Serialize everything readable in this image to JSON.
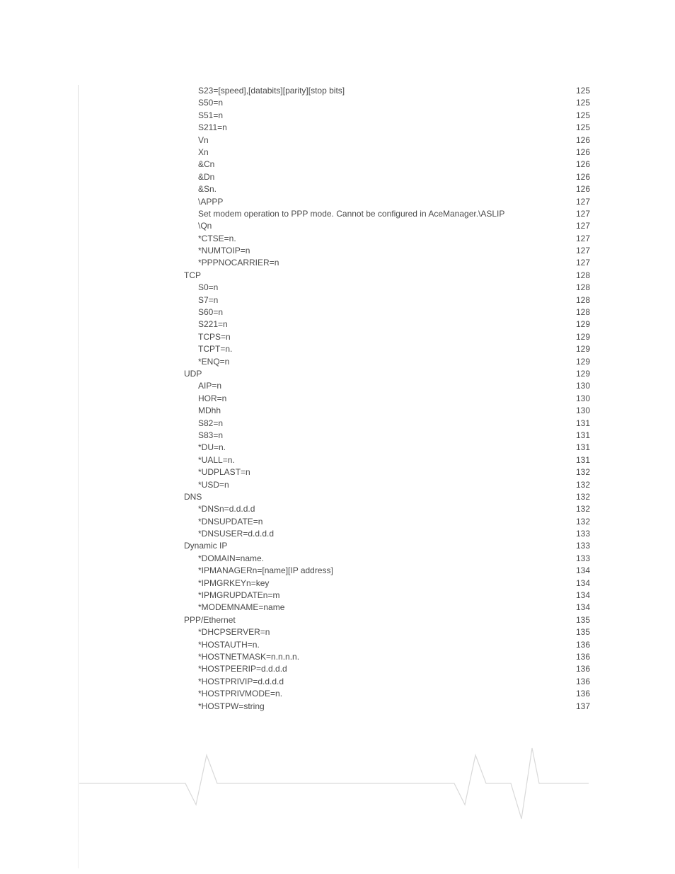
{
  "toc": [
    {
      "label": "S23=[speed],[databits][parity][stop bits]",
      "page": "125",
      "indent": 1
    },
    {
      "label": "S50=n",
      "page": "125",
      "indent": 1
    },
    {
      "label": "S51=n",
      "page": "125",
      "indent": 1
    },
    {
      "label": "S211=n",
      "page": "125",
      "indent": 1
    },
    {
      "label": "Vn",
      "page": "126",
      "indent": 1
    },
    {
      "label": "Xn",
      "page": "126",
      "indent": 1
    },
    {
      "label": "&Cn",
      "page": "126",
      "indent": 1
    },
    {
      "label": "&Dn",
      "page": "126",
      "indent": 1
    },
    {
      "label": "&Sn.",
      "page": "126",
      "indent": 1
    },
    {
      "label": "\\APPP",
      "page": "127",
      "indent": 1
    },
    {
      "label": "Set modem operation to PPP mode. Cannot be configured in AceManager.\\ASLIP",
      "page": "127",
      "indent": 1
    },
    {
      "label": "\\Qn",
      "page": "127",
      "indent": 1
    },
    {
      "label": "*CTSE=n.",
      "page": "127",
      "indent": 1
    },
    {
      "label": "*NUMTOIP=n",
      "page": "127",
      "indent": 1
    },
    {
      "label": "*PPPNOCARRIER=n",
      "page": "127",
      "indent": 1
    },
    {
      "label": "TCP",
      "page": "128",
      "indent": 0
    },
    {
      "label": "S0=n",
      "page": "128",
      "indent": 1
    },
    {
      "label": "S7=n",
      "page": "128",
      "indent": 1
    },
    {
      "label": "S60=n",
      "page": "128",
      "indent": 1
    },
    {
      "label": "S221=n",
      "page": "129",
      "indent": 1
    },
    {
      "label": "TCPS=n",
      "page": "129",
      "indent": 1
    },
    {
      "label": "TCPT=n.",
      "page": "129",
      "indent": 1
    },
    {
      "label": "*ENQ=n",
      "page": "129",
      "indent": 1
    },
    {
      "label": "UDP",
      "page": "129",
      "indent": 0
    },
    {
      "label": "AIP=n",
      "page": "130",
      "indent": 1
    },
    {
      "label": "HOR=n",
      "page": "130",
      "indent": 1
    },
    {
      "label": "MDhh",
      "page": "130",
      "indent": 1
    },
    {
      "label": "S82=n",
      "page": "131",
      "indent": 1
    },
    {
      "label": "S83=n",
      "page": "131",
      "indent": 1
    },
    {
      "label": "*DU=n.",
      "page": "131",
      "indent": 1
    },
    {
      "label": "*UALL=n.",
      "page": "131",
      "indent": 1
    },
    {
      "label": "*UDPLAST=n",
      "page": "132",
      "indent": 1
    },
    {
      "label": "*USD=n",
      "page": "132",
      "indent": 1
    },
    {
      "label": "DNS",
      "page": "132",
      "indent": 0
    },
    {
      "label": "*DNSn=d.d.d.d",
      "page": "132",
      "indent": 1
    },
    {
      "label": "*DNSUPDATE=n",
      "page": "132",
      "indent": 1
    },
    {
      "label": "*DNSUSER=d.d.d.d",
      "page": "133",
      "indent": 1
    },
    {
      "label": "Dynamic IP",
      "page": "133",
      "indent": 0
    },
    {
      "label": "*DOMAIN=name.",
      "page": "133",
      "indent": 1
    },
    {
      "label": "*IPMANAGERn=[name][IP address]",
      "page": "134",
      "indent": 1
    },
    {
      "label": "*IPMGRKEYn=key",
      "page": "134",
      "indent": 1
    },
    {
      "label": "*IPMGRUPDATEn=m",
      "page": "134",
      "indent": 1
    },
    {
      "label": "*MODEMNAME=name",
      "page": "134",
      "indent": 1
    },
    {
      "label": "PPP/Ethernet",
      "page": "135",
      "indent": 0
    },
    {
      "label": "*DHCPSERVER=n",
      "page": "135",
      "indent": 1
    },
    {
      "label": "*HOSTAUTH=n.",
      "page": "136",
      "indent": 1
    },
    {
      "label": "*HOSTNETMASK=n.n.n.n.",
      "page": "136",
      "indent": 1
    },
    {
      "label": "*HOSTPEERIP=d.d.d.d",
      "page": "136",
      "indent": 1
    },
    {
      "label": "*HOSTPRIVIP=d.d.d.d",
      "page": "136",
      "indent": 1
    },
    {
      "label": "*HOSTPRIVMODE=n.",
      "page": "136",
      "indent": 1
    },
    {
      "label": "*HOSTPW=string",
      "page": "137",
      "indent": 1
    }
  ]
}
